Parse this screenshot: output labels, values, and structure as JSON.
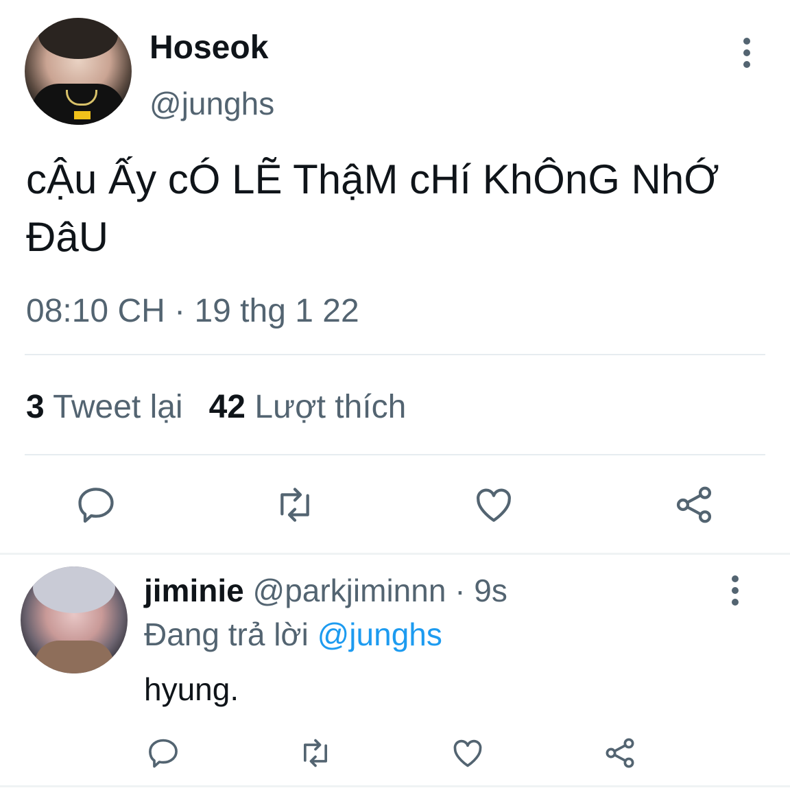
{
  "main_tweet": {
    "author_name": "Hoseok",
    "author_handle": "@junghs",
    "text": "cẬu Ấy cÓ LẼ ThậM cHí KhÔnG NhỚ ĐâU",
    "timestamp": "08:10 CH · 19 thg 1 22",
    "retweet_count": "3",
    "retweet_label": "Tweet lại",
    "like_count": "42",
    "like_label": "Lượt thích"
  },
  "reply": {
    "author_name": "jiminie",
    "author_handle": "@parkjiminnn",
    "time_ago": "· 9s",
    "replying_prefix": "Đang trả lời",
    "replying_to": "@junghs",
    "text": "hyung."
  },
  "icons": [
    "more-vertical-icon",
    "reply-icon",
    "retweet-icon",
    "like-icon",
    "share-icon"
  ],
  "colors": {
    "text": "#0f1419",
    "secondary": "#536471",
    "accent": "#1d9bf0",
    "divider": "#e6ecf0"
  }
}
